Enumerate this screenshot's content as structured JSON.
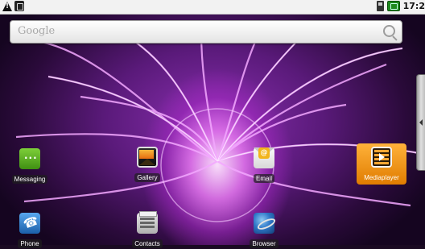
{
  "status_bar": {
    "left_icons": [
      "warning-icon",
      "usb-icon"
    ],
    "right_icons": [
      "sdcard-icon",
      "battery-icon"
    ],
    "time": "17:2"
  },
  "search": {
    "placeholder": "Google",
    "icon": "search-icon"
  },
  "home": {
    "shortcuts": [
      {
        "label": "Messaging",
        "icon": "messaging-icon"
      },
      {
        "label": "Gallery",
        "icon": "gallery-icon"
      },
      {
        "label": "Email",
        "icon": "email-icon"
      },
      {
        "label": "Mediaplayer",
        "icon": "media-icon",
        "selected": true
      },
      {
        "label": "Phone",
        "icon": "phone-icon"
      },
      {
        "label": "Contacts",
        "icon": "contacts-icon"
      },
      {
        "label": "Browser",
        "icon": "browser-icon"
      }
    ],
    "drawer_handle": "drawer-handle"
  },
  "colors": {
    "selection": "#F08A00",
    "wallpaper_primary": "#B23CD6"
  }
}
